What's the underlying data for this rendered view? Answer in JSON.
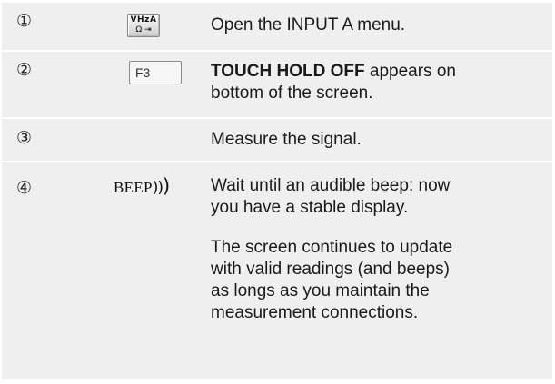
{
  "steps": [
    {
      "number": "①",
      "key": {
        "type": "button",
        "top": "VHzA",
        "bottom": "Ω ⇥"
      },
      "text": "Open the INPUT A menu."
    },
    {
      "number": "②",
      "key": {
        "type": "button",
        "label": "F3"
      },
      "text_bold": "TOUCH HOLD OFF",
      "text_line1_rest": " appears on",
      "text_line2": "bottom of the screen."
    },
    {
      "number": "③",
      "text": "Measure the signal."
    },
    {
      "number": "④",
      "beep": {
        "word": "BEEP",
        "waves_small": "))",
        "waves_big": ")"
      },
      "text_line1": "Wait until an audible beep: now",
      "text_line2": "you have a stable display.",
      "note_lines": [
        "The screen continues to update",
        "with valid readings (and beeps)",
        "as longs as you maintain the",
        "measurement connections."
      ]
    }
  ]
}
